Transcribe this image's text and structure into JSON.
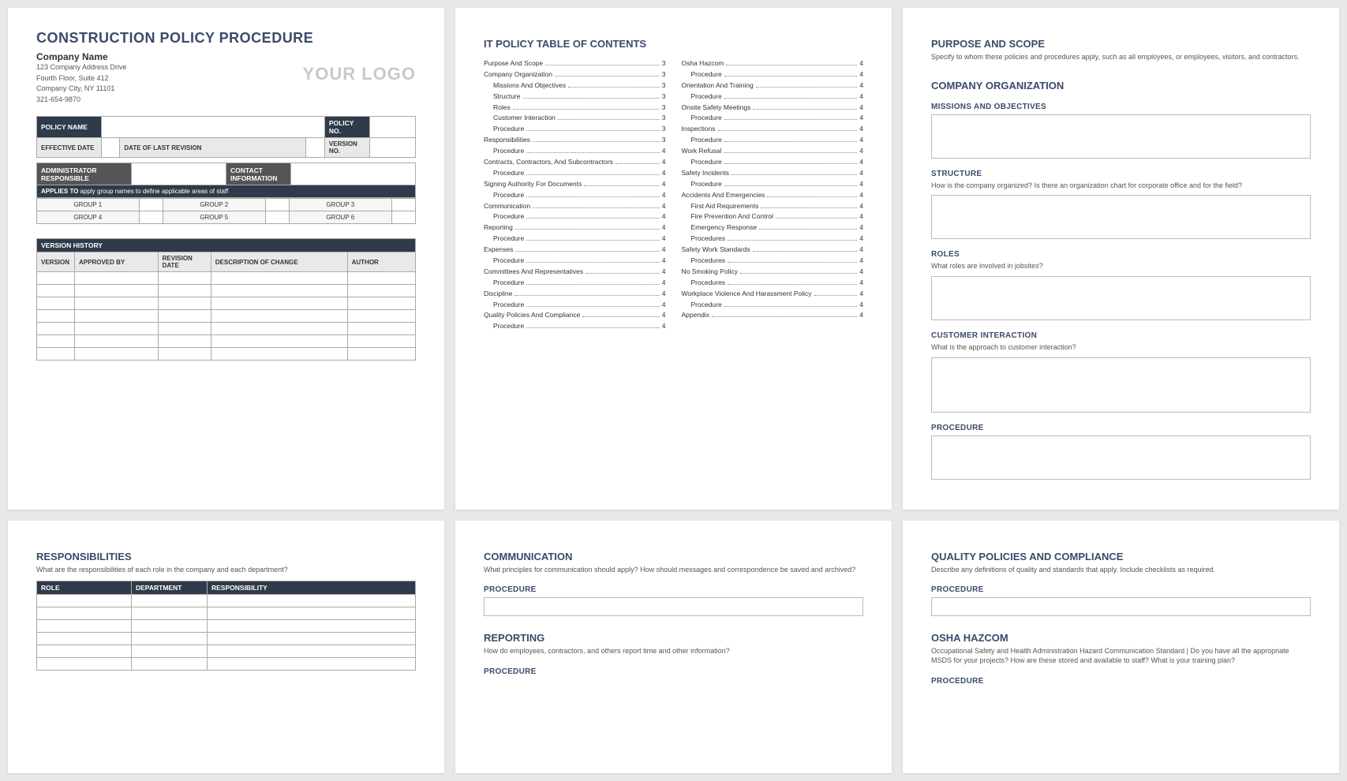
{
  "page1": {
    "title": "CONSTRUCTION POLICY PROCEDURE",
    "company_name": "Company Name",
    "addr1": "123 Company Address Drive",
    "addr2": "Fourth Floor, Suite 412",
    "addr3": "Company City, NY  11101",
    "phone": "321-654-9870",
    "logo": "YOUR LOGO",
    "labels": {
      "policy_name": "POLICY NAME",
      "policy_no": "POLICY NO.",
      "effective_date": "EFFECTIVE DATE",
      "date_last_rev": "DATE OF LAST REVISION",
      "version_no": "VERSION NO.",
      "admin_resp": "ADMINISTRATOR RESPONSIBLE",
      "contact_info": "CONTACT INFORMATION",
      "applies_to": "APPLIES TO",
      "applies_note": "apply group names to define applicable areas of staff"
    },
    "groups": [
      "GROUP 1",
      "GROUP 2",
      "GROUP 3",
      "GROUP 4",
      "GROUP 5",
      "GROUP 6"
    ],
    "version_history": "VERSION HISTORY",
    "vh_cols": [
      "VERSION",
      "APPROVED BY",
      "REVISION DATE",
      "DESCRIPTION OF CHANGE",
      "AUTHOR"
    ]
  },
  "page2": {
    "title": "IT POLICY TABLE OF CONTENTS",
    "left": [
      {
        "t": "Purpose And Scope",
        "n": "3",
        "i": 0
      },
      {
        "t": "Company Organization",
        "n": "3",
        "i": 0
      },
      {
        "t": "Missions And Objectives",
        "n": "3",
        "i": 1
      },
      {
        "t": "Structure",
        "n": "3",
        "i": 1
      },
      {
        "t": "Roles",
        "n": "3",
        "i": 1
      },
      {
        "t": "Customer Interaction",
        "n": "3",
        "i": 1
      },
      {
        "t": "Procedure",
        "n": "3",
        "i": 1
      },
      {
        "t": "Responsibilities",
        "n": "3",
        "i": 0
      },
      {
        "t": "Procedure",
        "n": "4",
        "i": 1
      },
      {
        "t": "Contracts, Contractors, And Subcontractors",
        "n": "4",
        "i": 0
      },
      {
        "t": "Procedure",
        "n": "4",
        "i": 1
      },
      {
        "t": "Signing Authority For Documents",
        "n": "4",
        "i": 0
      },
      {
        "t": "Procedure",
        "n": "4",
        "i": 1
      },
      {
        "t": "Communication",
        "n": "4",
        "i": 0
      },
      {
        "t": "Procedure",
        "n": "4",
        "i": 1
      },
      {
        "t": "Reporting",
        "n": "4",
        "i": 0
      },
      {
        "t": "Procedure",
        "n": "4",
        "i": 1
      },
      {
        "t": "Expenses",
        "n": "4",
        "i": 0
      },
      {
        "t": "Procedure",
        "n": "4",
        "i": 1
      },
      {
        "t": "Committees And Representatives",
        "n": "4",
        "i": 0
      },
      {
        "t": "Procedure",
        "n": "4",
        "i": 1
      },
      {
        "t": "Discipline",
        "n": "4",
        "i": 0
      },
      {
        "t": "Procedure",
        "n": "4",
        "i": 1
      },
      {
        "t": "Quality Policies And Compliance",
        "n": "4",
        "i": 0
      },
      {
        "t": "Procedure",
        "n": "4",
        "i": 1
      }
    ],
    "right": [
      {
        "t": "Osha Hazcom",
        "n": "4",
        "i": 0
      },
      {
        "t": "Procedure",
        "n": "4",
        "i": 1
      },
      {
        "t": "Orientation And Training",
        "n": "4",
        "i": 0
      },
      {
        "t": "Procedure",
        "n": "4",
        "i": 1
      },
      {
        "t": "Onsite Safety Meetings",
        "n": "4",
        "i": 0
      },
      {
        "t": "Procedure",
        "n": "4",
        "i": 1
      },
      {
        "t": "Inspections",
        "n": "4",
        "i": 0
      },
      {
        "t": "Procedure",
        "n": "4",
        "i": 1
      },
      {
        "t": "Work Refusal",
        "n": "4",
        "i": 0
      },
      {
        "t": "Procedure",
        "n": "4",
        "i": 1
      },
      {
        "t": "Safety Incidents",
        "n": "4",
        "i": 0
      },
      {
        "t": "Procedure",
        "n": "4",
        "i": 1
      },
      {
        "t": "Accidents And Emergencies",
        "n": "4",
        "i": 0
      },
      {
        "t": "First Aid Requirements",
        "n": "4",
        "i": 1
      },
      {
        "t": "Fire Prevention And Control",
        "n": "4",
        "i": 1
      },
      {
        "t": "Emergency Response",
        "n": "4",
        "i": 1
      },
      {
        "t": "Procedures",
        "n": "4",
        "i": 1
      },
      {
        "t": "Safety Work Standards",
        "n": "4",
        "i": 0
      },
      {
        "t": "Procedures",
        "n": "4",
        "i": 1
      },
      {
        "t": "No Smoking Policy",
        "n": "4",
        "i": 0
      },
      {
        "t": "Procedures",
        "n": "4",
        "i": 1
      },
      {
        "t": "Workplace Violence And Harassment Policy",
        "n": "4",
        "i": 0
      },
      {
        "t": "Procedure",
        "n": "4",
        "i": 1
      },
      {
        "t": "Appendix",
        "n": "4",
        "i": 0
      }
    ]
  },
  "page3": {
    "h_purpose": "PURPOSE AND SCOPE",
    "d_purpose": "Specify to whom these policies and procedures apply, such as all employees, or employees, visitors, and contractors.",
    "h_company": "COMPANY ORGANIZATION",
    "h_missions": "MISSIONS AND OBJECTIVES",
    "h_structure": "STRUCTURE",
    "d_structure": "How is the company organized? Is there an organization chart for corporate office and for the field?",
    "h_roles": "ROLES",
    "d_roles": "What roles are involved in jobsites?",
    "h_customer": "CUSTOMER INTERACTION",
    "d_customer": "What is the approach to customer interaction?",
    "h_procedure": "PROCEDURE"
  },
  "page4": {
    "h_resp": "RESPONSIBILITIES",
    "d_resp": "What are the responsibilities of each role in the company and each department?",
    "cols": [
      "ROLE",
      "DEPARTMENT",
      "RESPONSIBILITY"
    ]
  },
  "page5": {
    "h_comm": "COMMUNICATION",
    "d_comm": "What principles for communication should apply?  How should messages and correspondence be saved and archived?",
    "h_proc": "PROCEDURE",
    "h_report": "REPORTING",
    "d_report": "How do employees, contractors, and others report time and other information?"
  },
  "page6": {
    "h_quality": "QUALITY POLICIES AND COMPLIANCE",
    "d_quality": "Describe any definitions of quality and standards that apply.  Include checklists as required.",
    "h_proc": "PROCEDURE",
    "h_osha": "OSHA HAZCOM",
    "d_osha": "Occupational Safety and Health Administration Hazard Communication Standard |  Do you have all the appropriate MSDS for your projects?  How are these stored and available to staff?  What is your training plan?"
  }
}
